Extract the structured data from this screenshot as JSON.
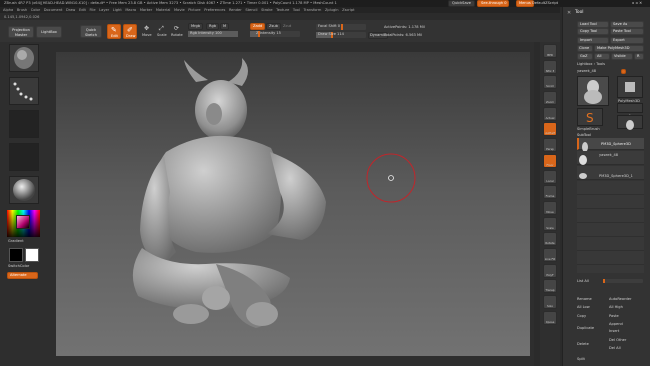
{
  "title_bar": {
    "text": "ZBrush 4R7 P3 (x64)[HEAD-HEAD-WIN10-X10] :  default*  •  Free Mem 23.8 GB  •  Active Mem 3273  •  Scratch Disk 4067  •  ZTime 1.271  •  Timer 0.001  •  PolyCount 1.178 MP  •  MeshCount 1",
    "quicksave": "QuickSave",
    "see_through": "See-through  0",
    "menus_label": "Menus",
    "default_zscript": "DefaultZScript"
  },
  "menu_bar": [
    "Alpha",
    "Brush",
    "Color",
    "Document",
    "Draw",
    "Edit",
    "File",
    "Layer",
    "Light",
    "Macro",
    "Marker",
    "Material",
    "Movie",
    "Picture",
    "Preferences",
    "Render",
    "Stencil",
    "Stroke",
    "Texture",
    "Tool",
    "Transform",
    "Zplugin",
    "Zscript"
  ],
  "coords_readout": "0.145,1.0942,0.026",
  "shelf": {
    "projection_master": "Projection Master",
    "lightbox": "LightBox",
    "quick_sketch": "Quick Sketch",
    "edit": "Edit",
    "draw": "Draw",
    "move": "Move",
    "scale": "Scale",
    "rotate": "Rotate",
    "mrgb": "Mrgb",
    "rgb": "Rgb",
    "m": "M",
    "zadd": "Zadd",
    "zsub": "Zsub",
    "zcut": "Zcut",
    "rgb_intensity": "Rgb Intensity 100",
    "z_intensity": "Z Intensity 15",
    "focal_shift": "Focal Shift 0",
    "draw_size": "Draw Size 114",
    "dynamic": "Dynamic",
    "active_points": "ActivePoints: 1.178 Mil",
    "total_points": "TotalPoints: 6.563 Mil"
  },
  "left_panel": {
    "gradient": "Gradient",
    "switch_color": "SwitchColor",
    "alternate": "Alternate"
  },
  "right_toolbar": [
    "BPR",
    "SPix 3",
    "Scroll",
    "Zoom",
    "Actual",
    "AAHalf",
    "Persp",
    "Floor",
    "Local",
    "Frame",
    "Move",
    "Scale",
    "Rotate",
    "Line Fill",
    "PolyF",
    "Transp",
    "Solo",
    "Xpose"
  ],
  "tool_panel": {
    "header": "Tool",
    "load_tool": "Load Tool",
    "save_as": "Save As",
    "copy_tool": "Copy Tool",
    "paste_tool": "Paste Tool",
    "import": "Import",
    "export": "Export",
    "clone": "Clone",
    "make_polymesh": "Make PolyMesh3D",
    "goz": "GoZ",
    "all": "All",
    "visible": "Visible",
    "r": "R",
    "lightbox_tools": "Lightbox › Tools",
    "current_tool": "yaseek_48",
    "thumb_labels": [
      "yaseek_48",
      "PolyMesh3D",
      "SimpleBrush",
      "yaseek_48"
    ],
    "subtool_header": "SubTool",
    "subtools": [
      "PM3D_Sphere3D",
      "yaseek_48",
      "PM3D_Sphere3D_1"
    ],
    "list_all": "List All",
    "rename": "Rename",
    "auto_reorder": "AutoReorder",
    "all_low": "All Low",
    "all_high": "All High",
    "copy": "Copy",
    "paste": "Paste",
    "duplicate": "Duplicate",
    "append": "Append",
    "insert": "Insert",
    "delete": "Delete",
    "del_other": "Del Other",
    "del_all": "Del All",
    "split": "Split"
  },
  "colors": {
    "accent": "#d9661a",
    "background": "#2b2b2b",
    "viewport_top": "#3a3a3a",
    "viewport_bottom": "#727272"
  }
}
